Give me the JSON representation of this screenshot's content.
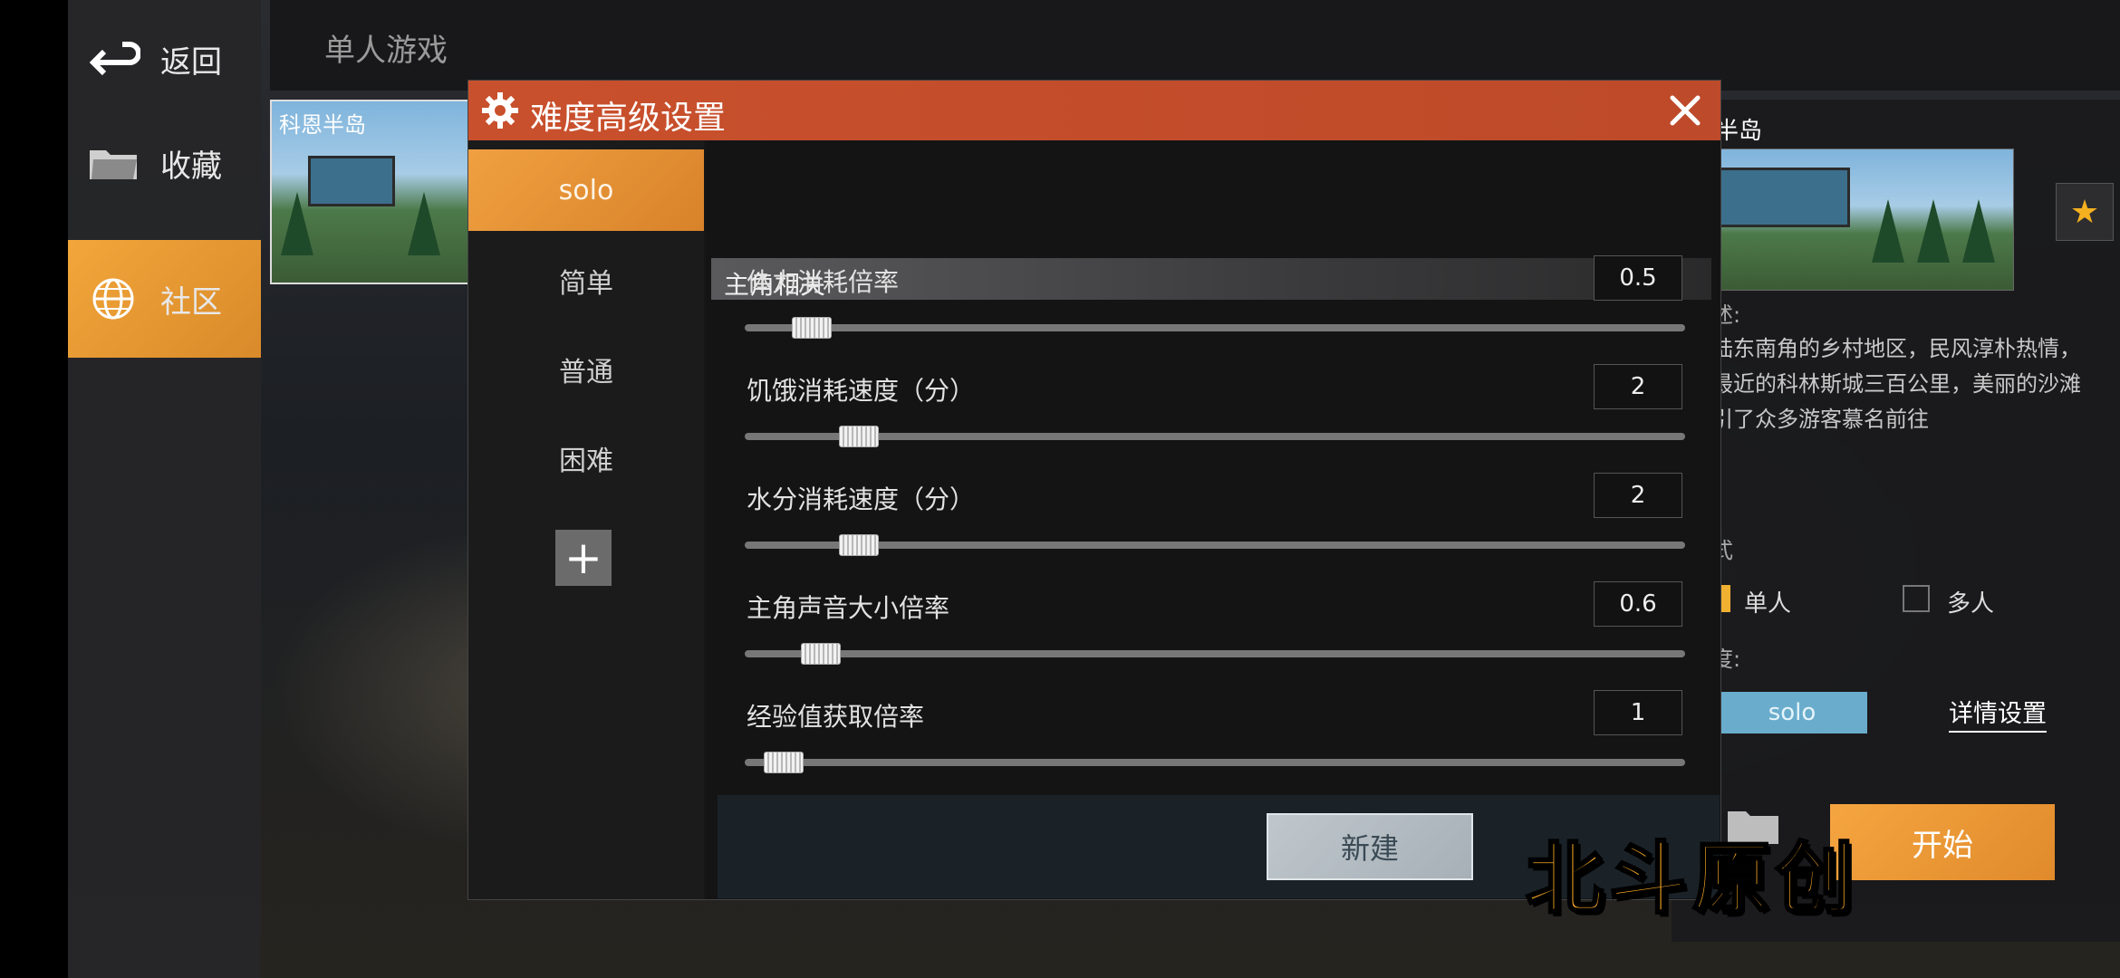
{
  "nav": {
    "back_label": "返回",
    "favorites_label": "收藏",
    "community_label": "社区"
  },
  "topbar": {
    "title": "单人游戏"
  },
  "map_card": {
    "title": "科恩半岛"
  },
  "right_panel": {
    "title": "恩半岛",
    "description_label": "描述:",
    "description": "大陆东南角的乡村地区，民风淳朴热情，距最近的科林斯城三百公里，美丽的沙滩吸引了众多游客慕名前往",
    "mode_label": "模式",
    "mode_options": [
      "单人",
      "多人"
    ],
    "mode_selected": "单人",
    "difficulty_label": "难度:",
    "difficulty_value": "solo",
    "detail_button": "详情设置",
    "start_button": "开始"
  },
  "dialog": {
    "title": "难度高级设置",
    "tabs": [
      "solo",
      "简单",
      "普通",
      "困难"
    ],
    "active_tab": "solo",
    "add_label": "+",
    "section_title": "主角相关",
    "settings": [
      {
        "label": "体力消耗倍率",
        "value": "0.5",
        "level": 0.05
      },
      {
        "label": "饥饿消耗速度（分）",
        "value": "2",
        "level": 0.1
      },
      {
        "label": "水分消耗速度（分）",
        "value": "2",
        "level": 0.1
      },
      {
        "label": "主角声音大小倍率",
        "value": "0.6",
        "level": 0.06
      },
      {
        "label": "经验值获取倍率",
        "value": "1",
        "level": 0.02
      }
    ],
    "new_button": "新建"
  },
  "watermark": "北斗原创",
  "colors": {
    "accent_orange": "#f0a040",
    "header_red": "#c9502c",
    "difficulty_blue": "#6aaccc"
  }
}
